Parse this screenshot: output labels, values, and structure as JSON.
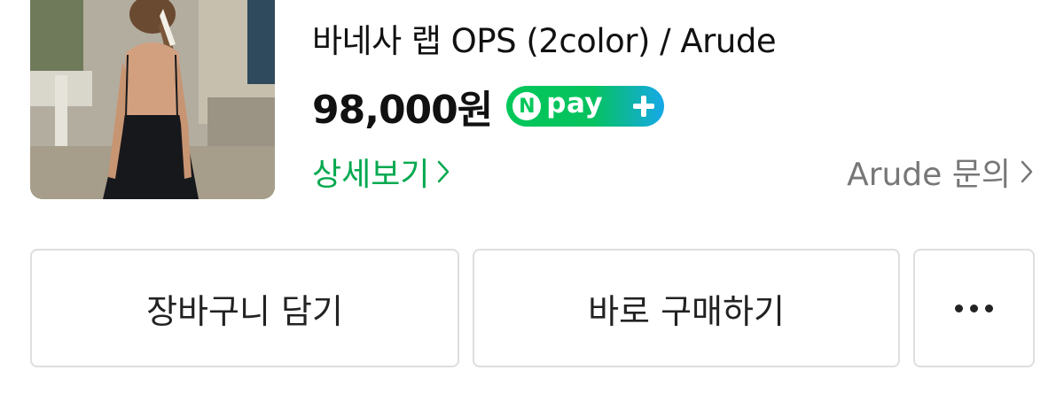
{
  "product": {
    "title": "바네사 랩 OPS (2color) / Arude",
    "price": "98,000원",
    "npay_badge": {
      "n": "N",
      "label": "pay",
      "icon": "plus-icon",
      "colors": {
        "green": "#03c75a",
        "blue": "#16a8e8"
      }
    },
    "detail_link": "상세보기",
    "inquiry_link": "Arude 문의"
  },
  "actions": {
    "cart_label": "장바구니 담기",
    "buy_label": "바로 구매하기",
    "more_icon": "more-dots-icon"
  },
  "colors": {
    "accent_green": "#03a94f",
    "muted_text": "#777777",
    "border": "#dedede"
  }
}
